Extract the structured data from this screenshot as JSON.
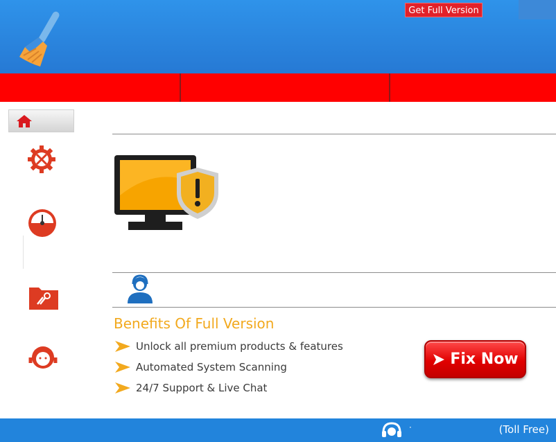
{
  "header": {
    "logo_icon": "broom-icon",
    "get_full_version_label": "Get Full Version"
  },
  "nav_tabs": [
    "",
    "",
    ""
  ],
  "sidebar": {
    "items": [
      {
        "icon": "home-icon"
      },
      {
        "icon": "gear-tools-icon"
      },
      {
        "icon": "speedometer-icon"
      },
      {
        "icon": "folder-repair-icon"
      },
      {
        "icon": "support-agent-icon"
      }
    ]
  },
  "main": {
    "alert_icon": "monitor-shield-warning-icon",
    "support_icon": "support-person-icon",
    "benefits": {
      "title": "Benefits Of Full Version",
      "items": [
        "Unlock all premium products & features",
        "Automated System Scanning",
        "24/7 Support & Live Chat"
      ]
    },
    "fix_button_label": "Fix Now"
  },
  "footer": {
    "icon": "headset-icon",
    "dot": "·",
    "toll_free": "(Toll Free)"
  },
  "colors": {
    "header_blue": "#2679d4",
    "nav_red": "#ff0000",
    "accent_orange": "#f2a91e",
    "button_red": "#e10000",
    "footer_blue": "#2284dc"
  }
}
